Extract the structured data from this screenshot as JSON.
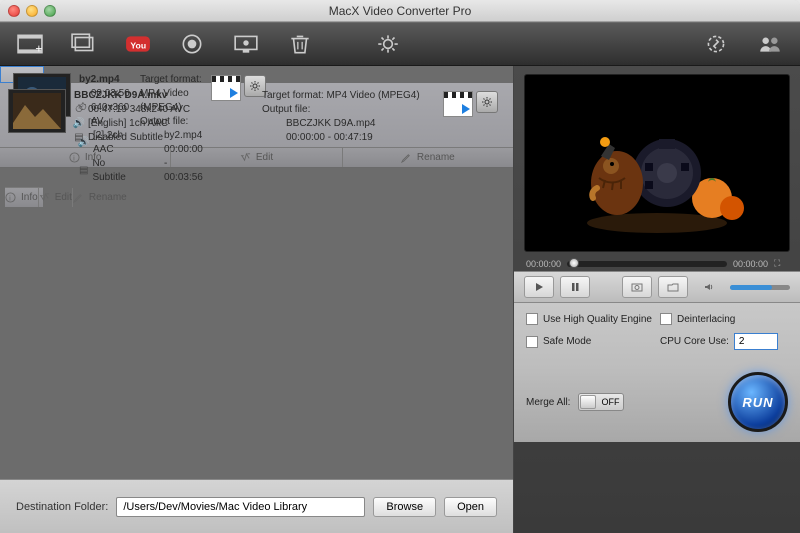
{
  "window": {
    "title": "MacX Video Converter Pro"
  },
  "toolbar": {
    "icons": [
      "add-video",
      "add-photo",
      "youtube",
      "record",
      "screen-record",
      "delete",
      "settings",
      "update",
      "account"
    ]
  },
  "files": [
    {
      "name": "by2.mp4",
      "duration_res": "00:03:56 640x360 AV",
      "audio": "[2] 2ch AAC",
      "subtitle": "No Subtitle",
      "target_format": "Target format: MP4 Video (MPEG4)",
      "output_label": "Output file:",
      "output_file": "by2.mp4",
      "time_range": "00:00:00 - 00:03:56"
    },
    {
      "name": "BBCZJKK D9A.mkv",
      "duration_res": "00:47:19 348x240 AVC",
      "audio": "[English] 1ch AAC",
      "subtitle": "Disabled Subtitle",
      "target_format": "Target format: MP4 Video (MPEG4)",
      "output_label": "Output file:",
      "output_file": "BBCZJKK D9A.mp4",
      "time_range": "00:00:00 - 00:47:19"
    }
  ],
  "file_actions": {
    "info": "Info",
    "edit": "Edit",
    "rename": "Rename"
  },
  "dest": {
    "label": "Destination Folder:",
    "path": "/Users/Dev/Movies/Mac Video Library",
    "browse": "Browse",
    "open": "Open"
  },
  "playback": {
    "start": "00:00:00",
    "end": "00:00:00"
  },
  "options": {
    "high_quality": "Use High Quality Engine",
    "deinterlacing": "Deinterlacing",
    "safe_mode": "Safe Mode",
    "cpu_label": "CPU Core Use:",
    "cpu_value": "2"
  },
  "merge": {
    "label": "Merge All:",
    "state": "OFF"
  },
  "run": "RUN"
}
